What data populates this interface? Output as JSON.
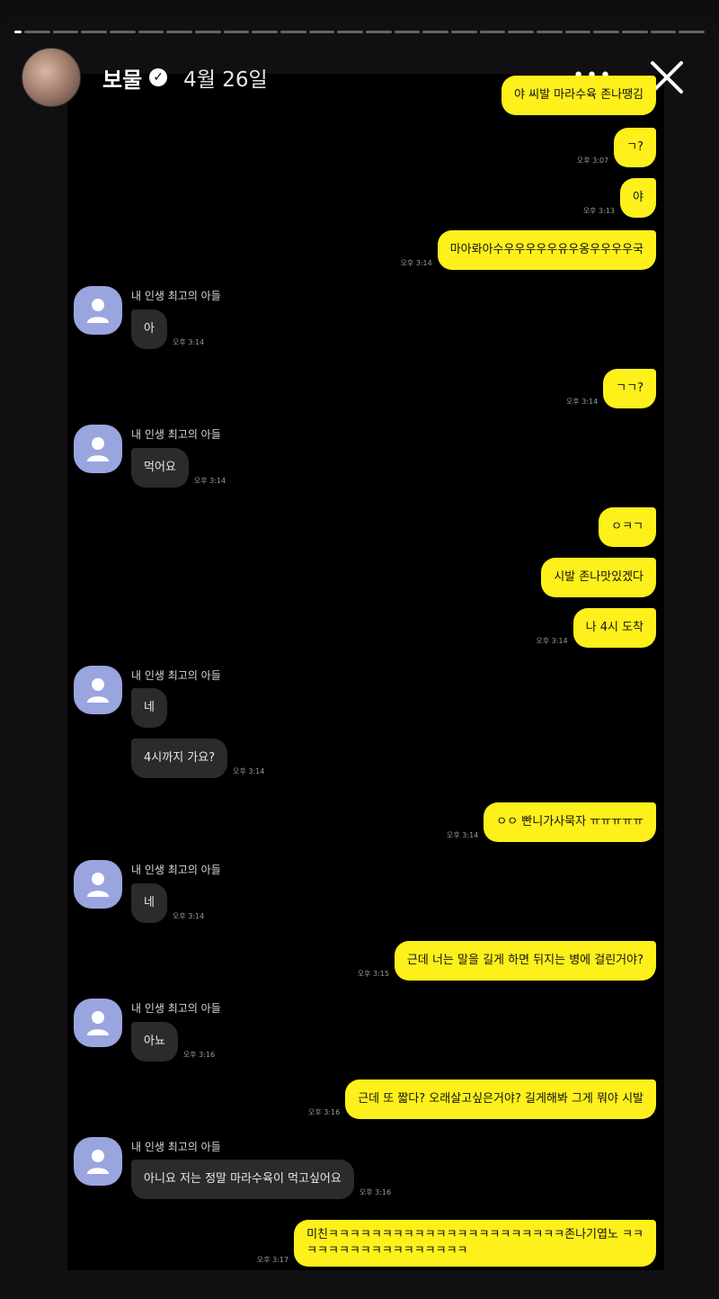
{
  "story": {
    "username": "보물",
    "date": "4월 26일"
  },
  "chat": {
    "sender_name": "내 인생 최고의 아들",
    "messages": [
      {
        "side": "me",
        "text": "야 씨발 마라수육 존나땡김",
        "time": ""
      },
      {
        "side": "me",
        "text": "ㄱ?",
        "time": "오후 3:07"
      },
      {
        "side": "me",
        "text": "야",
        "time": "오후 3:13"
      },
      {
        "side": "me",
        "text": "마아롸아수우우우우우유우옹우우우우국",
        "time": "오후 3:14"
      },
      {
        "side": "them",
        "text": "아",
        "time": "오후 3:14"
      },
      {
        "side": "me",
        "text": "ㄱㄱ?",
        "time": "오후 3:14"
      },
      {
        "side": "them",
        "text": "먹어요",
        "time": "오후 3:14"
      },
      {
        "side": "me",
        "text": "ㅇㅋㄱ",
        "time": ""
      },
      {
        "side": "me",
        "text": "시발 존나맛있겠다",
        "time": ""
      },
      {
        "side": "me",
        "text": "나 4시 도착",
        "time": "오후 3:14"
      },
      {
        "side": "them",
        "text": "네",
        "time": ""
      },
      {
        "side": "them",
        "text": "4시까지 가요?",
        "time": "오후 3:14"
      },
      {
        "side": "me",
        "text": "ㅇㅇ 빤니가사묵자 ㅠㅠㅠㅠㅠ",
        "time": "오후 3:14"
      },
      {
        "side": "them",
        "text": "네",
        "time": "오후 3:14"
      },
      {
        "side": "me",
        "text": "근데 너는 말을 길게 하면 뒤지는 병에 걸린거야?",
        "time": "오후 3:15"
      },
      {
        "side": "them",
        "text": "아뇨",
        "time": "오후 3:16"
      },
      {
        "side": "me",
        "text": "근데 또 짧다? 오래살고싶은거야? 길게해봐 그게 뭐야 시발",
        "time": "오후 3:16"
      },
      {
        "side": "them",
        "text": "아니요 저는 정말 마라수육이 먹고싶어요",
        "time": "오후 3:16"
      },
      {
        "side": "me",
        "text": "미친ㅋㅋㅋㅋㅋㅋㅋㅋㅋㅋㅋㅋㅋㅋㅋㅋㅋㅋㅋㅋㅋㅋ존나기엽노 ㅋㅋ",
        "text2": "ㅋㅋㅋㅋㅋㅋㅋㅋㅋㅋㅋㅋㅋㅋㅋ",
        "time": "오후 3:17"
      }
    ]
  },
  "icons": {
    "more": "more-dots-icon",
    "close": "close-icon",
    "verified": "verified-badge-icon",
    "default_profile": "person-icon"
  },
  "colors": {
    "my_bubble": "#fef01b",
    "their_bubble": "#2b2b2b",
    "profile_bg": "#9aa4df"
  }
}
